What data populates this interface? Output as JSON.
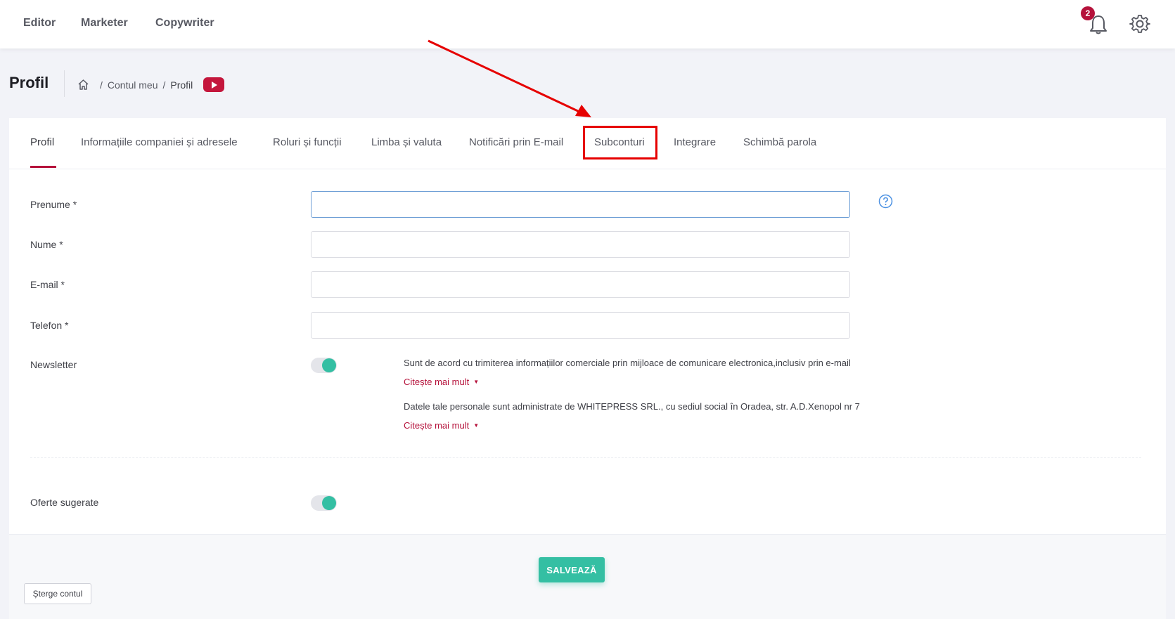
{
  "topnav": {
    "items": [
      "Editor",
      "Marketer",
      "Copywriter"
    ],
    "notification_count": "2",
    "icons": {
      "bell": "bell-icon",
      "settings": "gear-icon"
    }
  },
  "subheader": {
    "title": "Profil",
    "breadcrumb": {
      "home_icon": "home-icon",
      "items": [
        "Contul meu",
        "Profil"
      ],
      "separator": "/"
    },
    "video_icon": "youtube-icon"
  },
  "tabs": {
    "items": [
      "Profil",
      "Informațiile companiei și adresele",
      "Roluri și funcții",
      "Limba și valuta",
      "Notificări prin E-mail",
      "Subconturi",
      "Integrare",
      "Schimbă parola"
    ],
    "active": "Profil"
  },
  "form": {
    "first_name": {
      "label": "Prenume *",
      "value": ""
    },
    "last_name": {
      "label": "Nume *",
      "value": ""
    },
    "email": {
      "label": "E-mail *",
      "value": ""
    },
    "phone": {
      "label": "Telefon *",
      "value": ""
    },
    "newsletter": {
      "label": "Newsletter",
      "enabled": true,
      "consent_1": "Sunt de acord cu trimiterea informațiilor comerciale prin mijloace de comunicare electronica,inclusiv prin e-mail",
      "consent_2": "Datele tale personale sunt administrate de WHITEPRESS SRL., cu sediul social în Oradea, str. A.D.Xenopol nr 7",
      "read_more": "Citește mai mult"
    },
    "suggested_offers": {
      "label": "Oferte sugerate",
      "enabled": true
    }
  },
  "actions": {
    "save": "SALVEAZĂ",
    "delete_account": "Șterge contul"
  },
  "colors": {
    "accent": "#b5123b",
    "success": "#34bfa3",
    "annotation": "#e60000"
  }
}
